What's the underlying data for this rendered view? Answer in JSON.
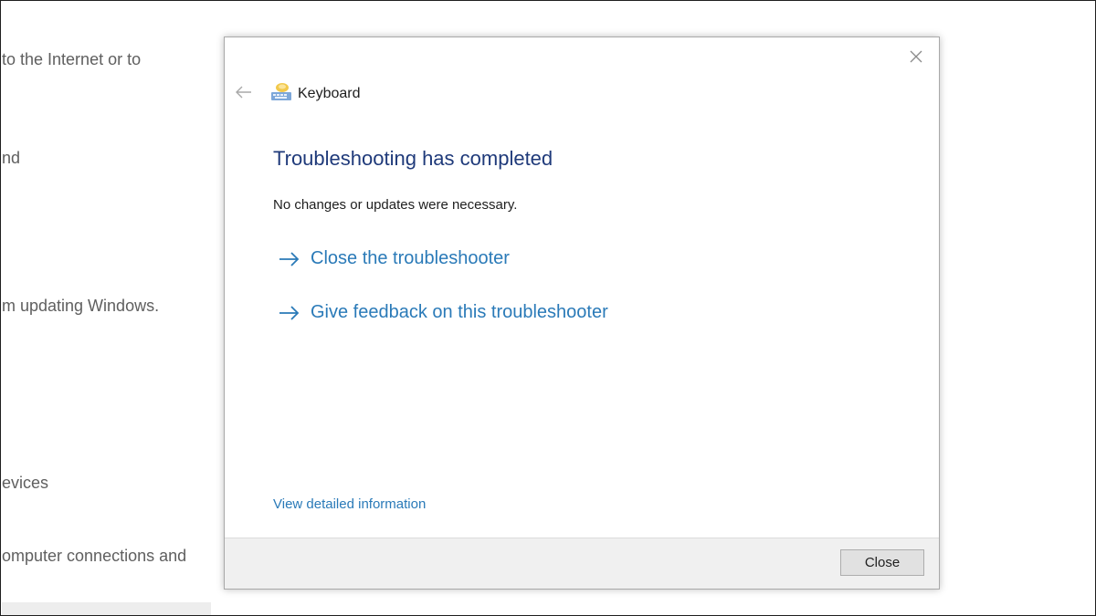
{
  "background": {
    "fragments": [
      "to the Internet or to",
      "nd",
      "m updating Windows.",
      "evices",
      "omputer connections and"
    ]
  },
  "dialog": {
    "title": "Keyboard",
    "heading": "Troubleshooting has completed",
    "message": "No changes or updates were necessary.",
    "links": [
      "Close the troubleshooter",
      "Give feedback on this troubleshooter"
    ],
    "detail_link": "View detailed information",
    "close_button": "Close"
  },
  "colors": {
    "heading": "#1f3a7a",
    "link": "#2a7ab8",
    "footer": "#f0f0f0"
  },
  "icons": {
    "close": "close-icon",
    "back": "back-arrow-icon",
    "app": "keyboard-icon",
    "link": "arrow-right-icon"
  }
}
